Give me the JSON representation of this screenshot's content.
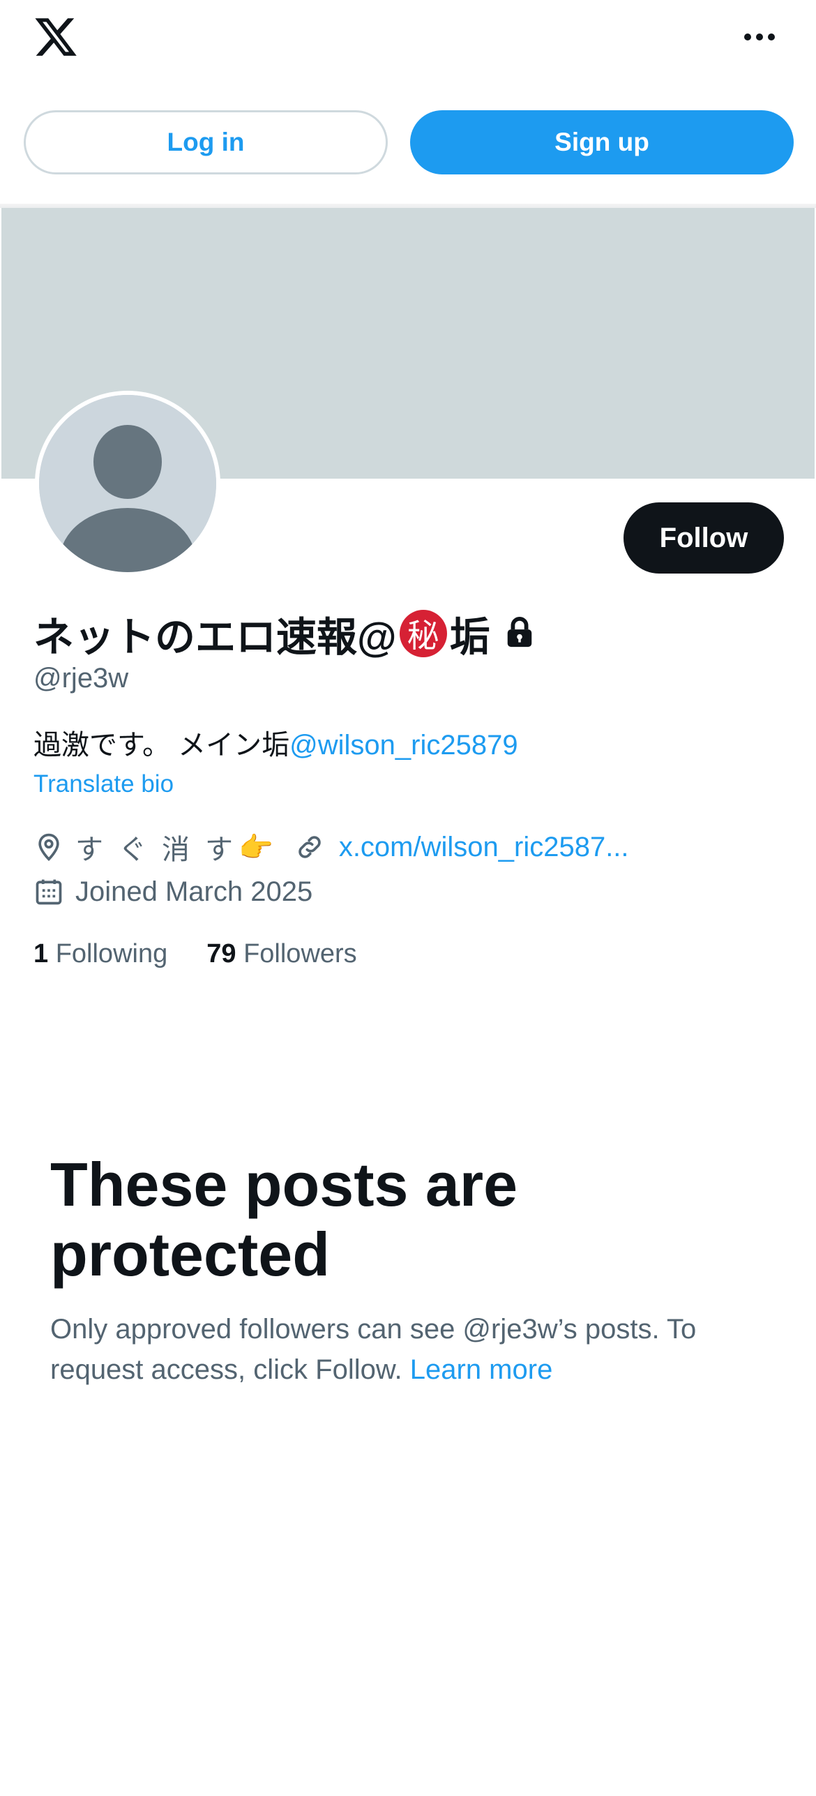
{
  "header": {
    "logo_icon": "x-logo-icon",
    "more_icon": "more-horizontal-icon"
  },
  "auth": {
    "login_label": "Log in",
    "signup_label": "Sign up"
  },
  "profile": {
    "name_part1": "ネットのエロ速報@",
    "name_badge": "秘",
    "name_part2": "垢",
    "lock_icon": "lock-icon",
    "handle": "@rje3w",
    "follow_label": "Follow",
    "bio_text": "過激です。 メイン垢",
    "bio_mention": "@wilson_ric25879",
    "translate_label": "Translate bio",
    "location": "すぐ消す",
    "location_emoji": "👉",
    "website": "x.com/wilson_ric2587...",
    "joined": "Joined March 2025",
    "following_count": "1",
    "following_label": "Following",
    "followers_count": "79",
    "followers_label": "Followers"
  },
  "protected": {
    "title": "These posts are protected",
    "body": "Only approved followers can see @rje3w’s posts. To request access, click Follow.",
    "learn_more": "Learn more"
  },
  "colors": {
    "accent": "#1d9bf0",
    "text": "#0f1419",
    "secondary_text": "#536471",
    "banner": "#cfd9db",
    "badge": "#d62134"
  }
}
